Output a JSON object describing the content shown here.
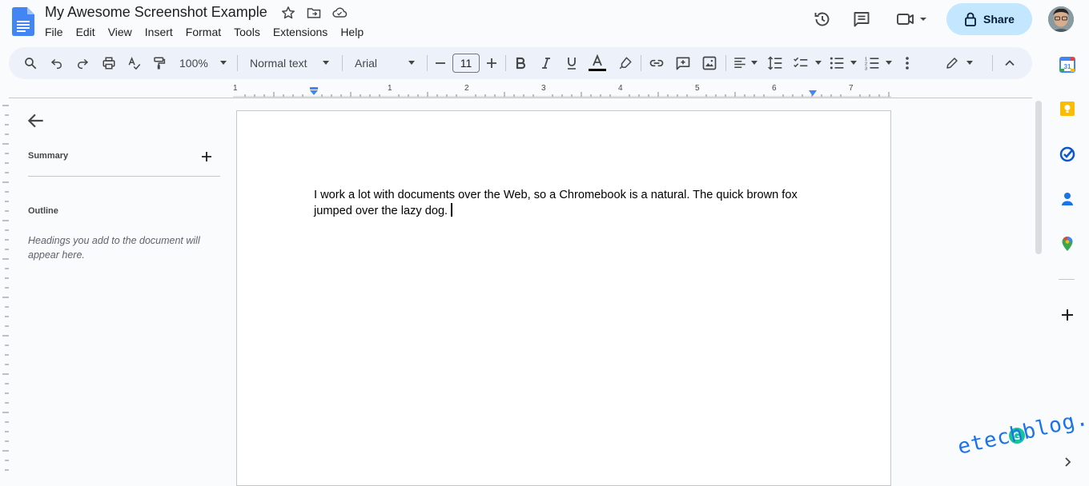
{
  "app": {
    "doc_title": "My Awesome Screenshot Example",
    "share_label": "Share"
  },
  "menu": {
    "items": [
      "File",
      "Edit",
      "View",
      "Insert",
      "Format",
      "Tools",
      "Extensions",
      "Help"
    ]
  },
  "toolbar": {
    "zoom": "100%",
    "style": "Normal text",
    "font": "Arial",
    "font_size": "11"
  },
  "ruler": {
    "labels": [
      "1",
      "1",
      "2",
      "3",
      "4",
      "5",
      "6",
      "7"
    ]
  },
  "outline_panel": {
    "summary_label": "Summary",
    "outline_label": "Outline",
    "hint": "Headings you add to the document will appear here."
  },
  "document": {
    "text": "I work a lot with documents over the Web, so a Chromebook is a natural. The quick brown fox jumped over the lazy dog."
  },
  "side_panel": {
    "calendar_day": "31"
  },
  "watermark": {
    "text": "etechblog.cz",
    "badge": "G"
  },
  "colors": {
    "accent": "#0b57d0",
    "share_bg": "#c2e7ff",
    "toolbar_bg": "#edf2fa",
    "page_bg": "#f9fbfd"
  },
  "icons": [
    "docs-icon",
    "star-icon",
    "move-folder-icon",
    "cloud-saved-icon",
    "history-icon",
    "comments-icon",
    "meet-icon",
    "lock-icon",
    "search-icon",
    "undo-icon",
    "redo-icon",
    "print-icon",
    "spellcheck-icon",
    "paint-format-icon",
    "bold-icon",
    "italic-icon",
    "underline-icon",
    "text-color-icon",
    "highlight-icon",
    "link-icon",
    "add-comment-icon",
    "image-icon",
    "align-icon",
    "line-spacing-icon",
    "checklist-icon",
    "bulleted-list-icon",
    "numbered-list-icon",
    "more-icon",
    "editing-mode-icon",
    "collapse-icon",
    "arrow-back-icon",
    "plus-icon",
    "calendar-icon",
    "keep-icon",
    "tasks-icon",
    "contacts-icon",
    "maps-icon"
  ]
}
